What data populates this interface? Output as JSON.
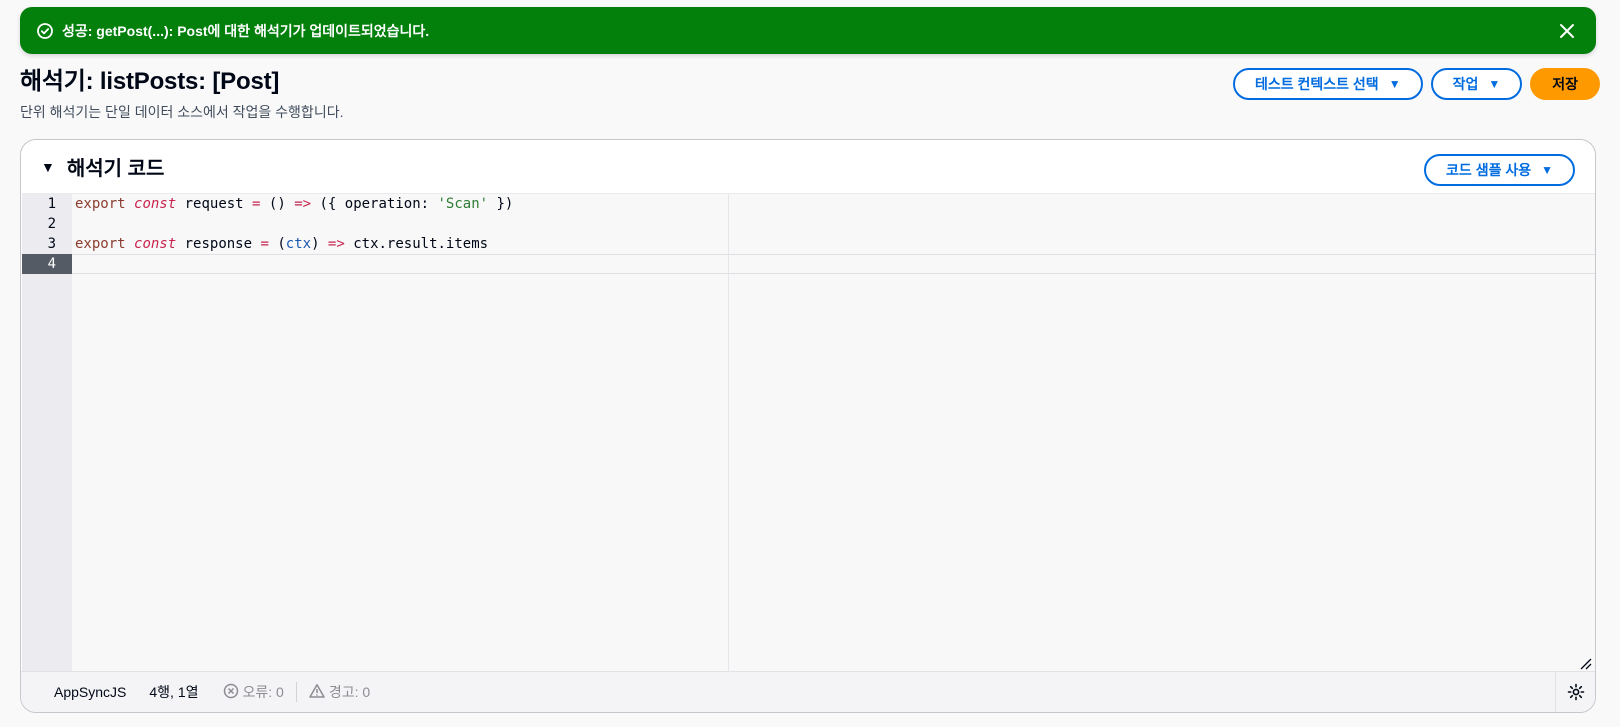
{
  "flash": {
    "message": "성공: getPost(...): Post에 대한 해석기가 업데이트되었습니다.",
    "icon": "check-circle-icon",
    "close_icon": "close-icon",
    "color": "#037f0c"
  },
  "header": {
    "title": "해석기: listPosts: [Post]",
    "description": "단위 해석기는 단일 데이터 소스에서 작업을 수행합니다.",
    "test_context_label": "테스트 컨텍스트 선택",
    "actions_label": "작업",
    "save_label": "저장"
  },
  "code_section": {
    "title": "해석기 코드",
    "sample_button_label": "코드 샘플 사용",
    "line_numbers": [
      "1",
      "2",
      "3",
      "4"
    ],
    "active_line": 4,
    "lines": [
      "export const request = () => ({ operation: 'Scan' })",
      "",
      "export const response = (ctx) => ctx.result.items",
      ""
    ]
  },
  "status_bar": {
    "language": "AppSyncJS",
    "cursor": "4행, 1열",
    "errors": "오류: 0",
    "warnings": "경고: 0"
  },
  "colors": {
    "accent": "#006ce0",
    "primary_button": "#ff9900",
    "success": "#037f0c"
  }
}
